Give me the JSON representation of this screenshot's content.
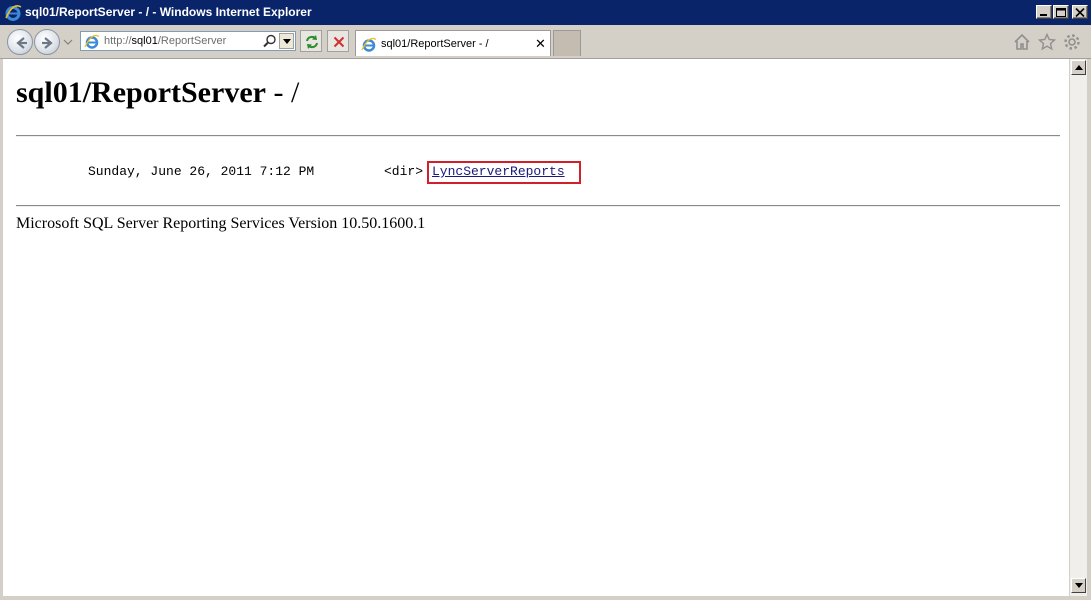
{
  "window": {
    "title": "sql01/ReportServer - / - Windows Internet Explorer"
  },
  "toolbar": {
    "url_prefix": "http://",
    "url_host": "sql01",
    "url_path": "/ReportServer"
  },
  "tab": {
    "label": "sql01/ReportServer - /",
    "close_glyph": "✕"
  },
  "page": {
    "heading_main": "sql01/ReportServer",
    "heading_suffix": " - /",
    "listing": {
      "date": "Sunday, June 26, 2011 7:12 PM",
      "type": "<dir>",
      "link": "LyncServerReports"
    },
    "footer_version": "Microsoft SQL Server Reporting Services Version 10.50.1600.1"
  },
  "icons": {
    "back": "back-arrow-icon",
    "forward": "forward-arrow-icon",
    "ie": "ie-logo-icon",
    "search": "search-icon",
    "refresh": "refresh-icon",
    "stop": "stop-icon",
    "home": "home-icon",
    "favorites": "star-icon",
    "tools": "gear-icon"
  },
  "colors": {
    "titlebar": "#0a246a",
    "highlight": "#d0202a",
    "link": "#1a1a7a"
  }
}
